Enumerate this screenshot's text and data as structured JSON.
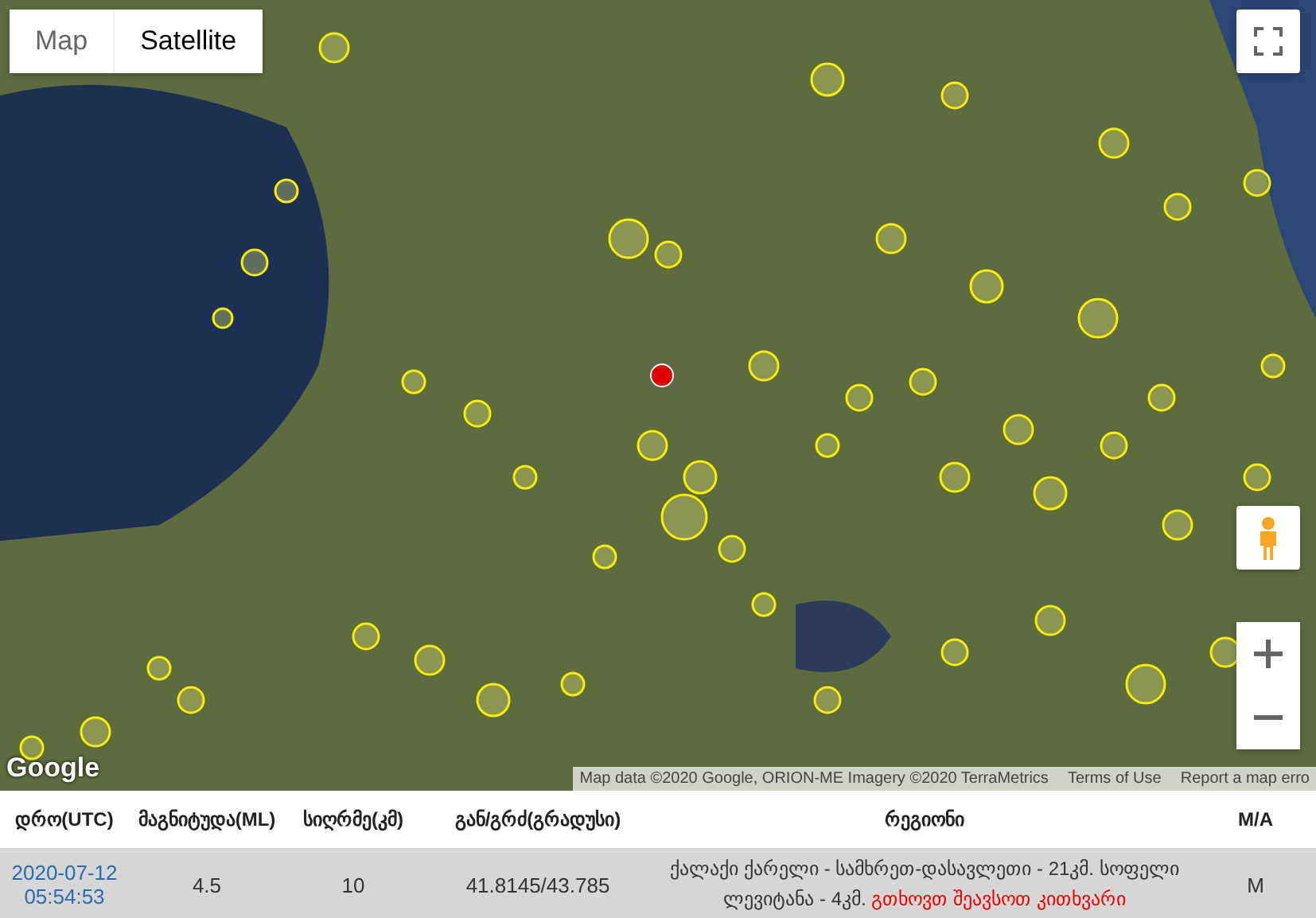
{
  "map": {
    "type_tabs": [
      {
        "label": "Map",
        "selected": false
      },
      {
        "label": "Satellite",
        "selected": true
      }
    ],
    "logo": "Google",
    "attribution": {
      "text": "Map data ©2020 Google, ORION-ME Imagery ©2020 TerraMetrics",
      "terms": "Terms of Use",
      "report": "Report a map erro"
    }
  },
  "table": {
    "columns": [
      "დრო(UTC)",
      "მაგნიტუდა(ML)",
      "სიღრმე(კმ)",
      "გან/გრძ(გრადუსი)",
      "რეგიონი",
      "M/A"
    ],
    "rows": [
      {
        "time": "2020-07-12 05:54:53",
        "magnitude": "4.5",
        "depth": "10",
        "coords": "41.8145/43.785",
        "region": "ქალაქი ქარელი - სამხრეთ-დასავლეთი - 21კმ. სოფელი ლევიტანა - 4კმ.",
        "region_link": "გთხოვთ შეავსოთ კითხვარი",
        "ma": "M"
      }
    ]
  }
}
